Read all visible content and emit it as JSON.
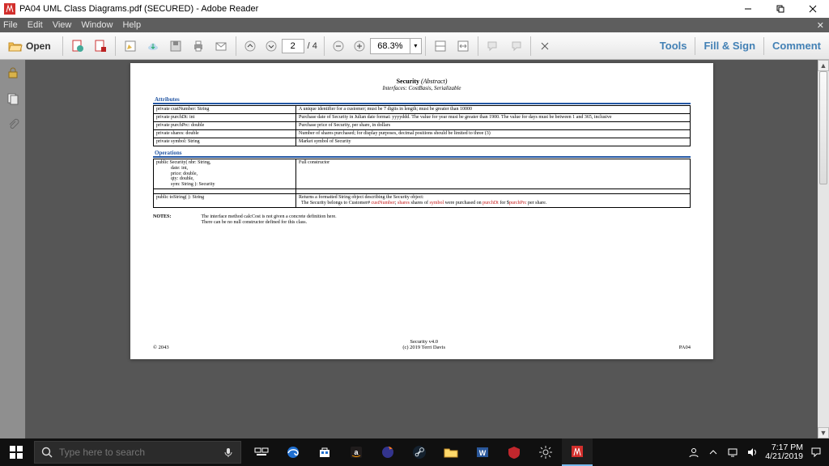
{
  "title": "PA04 UML Class Diagrams.pdf (SECURED) - Adobe Reader",
  "menubar": {
    "items": [
      "File",
      "Edit",
      "View",
      "Window",
      "Help"
    ]
  },
  "toolbar": {
    "open_label": "Open",
    "page_current": "2",
    "page_total": "/ 4",
    "zoom": "68.3%",
    "right": {
      "tools": "Tools",
      "sign": "Fill & Sign",
      "comment": "Comment"
    }
  },
  "page": {
    "title": "Security",
    "title_note": "(Abstract)",
    "subtitle": "Interfaces: CostBasis, Serializable",
    "sections": {
      "attributes": "Attributes",
      "operations": "Operations"
    },
    "attributes": [
      {
        "sig": "private custNumber: String",
        "desc": "A unique identifier for a customer; must be 7 digits in length; must be greater than 10000"
      },
      {
        "sig": "private purchDt: int",
        "desc": "Purchase date of Security in Julian date format: yyyyddd. The value for year must be greater than 1900. The value for days must be between 1 and 365, inclusive"
      },
      {
        "sig": "private purchPrc: double",
        "desc": "Purchase price of Security, per share, in dollars"
      },
      {
        "sig": "private shares: double",
        "desc": "Number of shares purchased; for display purposes, decimal positions should be limited to three (3)"
      },
      {
        "sig": "private symbol: String",
        "desc": "Market symbol of Security"
      }
    ],
    "operations": [
      {
        "sig": "public Security( nbr: String,\n            date: int,\n            price: double,\n            qty: double,\n            sym: String ): Security",
        "desc": "Full constructor"
      },
      {
        "sig": "public toString( ): String",
        "desc": "Returns a formatted String object describing the Security object:\n  The Security belongs to Customer# custNumber; shares shares of symbol were purchased on purchDt for $purchPrc per share."
      }
    ],
    "notes_label": "NOTES:",
    "notes": [
      "The interface method calcCost is not given a concrete definition here.",
      "There can be no null constructor defined for this class."
    ],
    "footer": {
      "left": "© 2043",
      "mid1": "Security v4.0",
      "mid2": "(c) 2019 Terri Davis",
      "right": "PA04"
    }
  },
  "taskbar": {
    "search_placeholder": "Type here to search",
    "time": "7:17 PM",
    "date": "4/21/2019"
  },
  "colors": {
    "accent": "#d22f2c",
    "link": "#2356a3"
  }
}
